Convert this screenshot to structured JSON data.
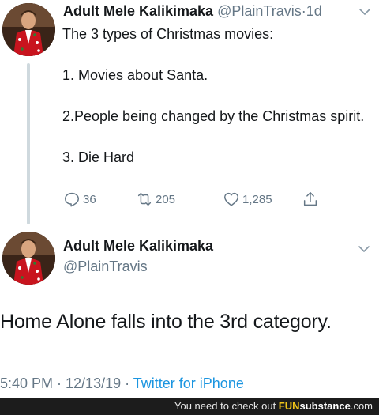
{
  "tweet1": {
    "author_name": "Adult Mele Kalikimaka",
    "handle": "@PlainTravis",
    "time": "1d",
    "body_lines": [
      "The 3 types of Christmas movies:",
      "1. Movies about Santa.",
      "2.People being changed by the Christmas spirit.",
      "3. Die Hard"
    ],
    "actions": {
      "replies": "36",
      "retweets": "205",
      "likes": "1,285"
    }
  },
  "tweet2": {
    "author_name": "Adult Mele Kalikimaka",
    "handle": "@PlainTravis",
    "body": "Home Alone falls into the 3rd category.",
    "timestamp": "5:40 PM · 12/13/19 · ",
    "source": "Twitter for iPhone"
  },
  "footer": {
    "text": "You need to check out ",
    "brand_main": "FUN",
    "brand_rest": "substance",
    "brand_tld": ".com"
  },
  "colors": {
    "text": "#14171a",
    "secondary": "#657786",
    "link": "#1b95e0",
    "thread_line": "#cfd9de"
  },
  "icons": [
    "chevron-down-icon",
    "reply-icon",
    "retweet-icon",
    "like-icon",
    "share-icon"
  ]
}
